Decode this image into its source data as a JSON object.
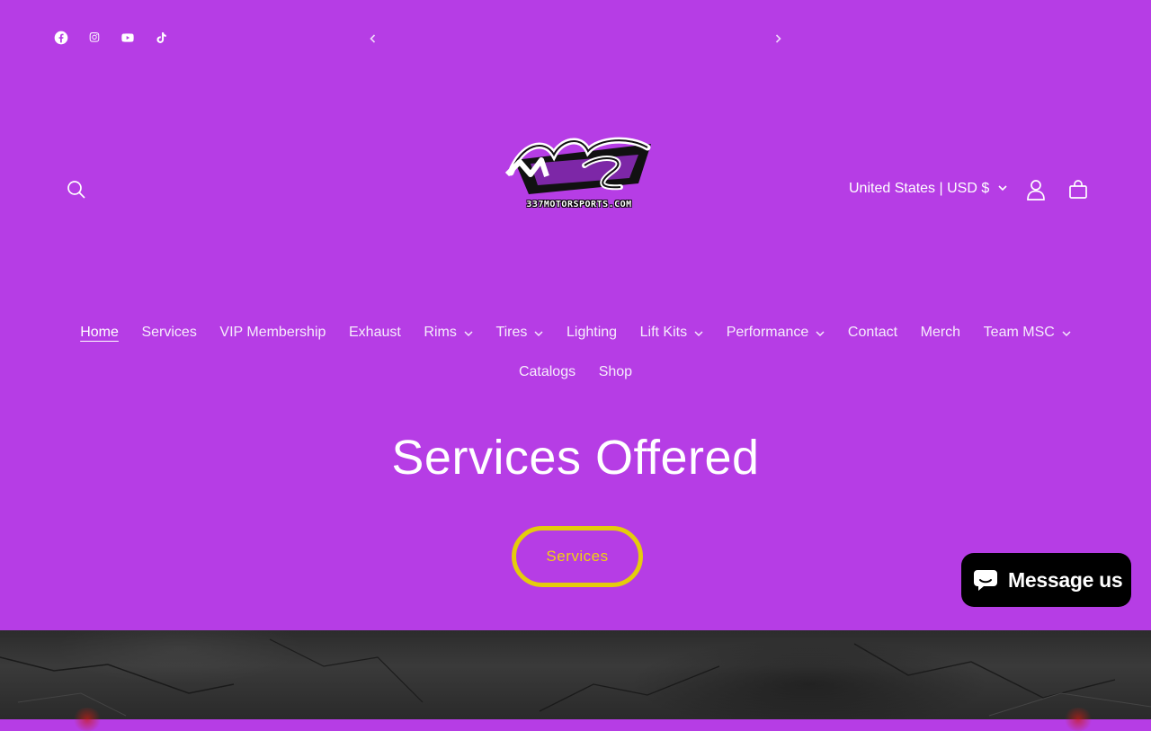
{
  "announcement": {
    "social_icons": [
      "facebook-icon",
      "instagram-icon",
      "youtube-icon",
      "tiktok-icon"
    ],
    "prev_icon": "chevron-left-icon",
    "next_icon": "chevron-right-icon"
  },
  "header": {
    "logo_text": "337MOTORSPORTS.COM",
    "logo_letters": "MS",
    "country_selector": "United States | USD $",
    "icons": {
      "search": "search-icon",
      "account": "user-icon",
      "cart": "bag-icon"
    }
  },
  "nav": {
    "row1": [
      {
        "label": "Home",
        "dropdown": false,
        "active": true
      },
      {
        "label": "Services",
        "dropdown": false
      },
      {
        "label": "VIP Membership",
        "dropdown": false
      },
      {
        "label": "Exhaust",
        "dropdown": false
      },
      {
        "label": "Rims",
        "dropdown": true
      },
      {
        "label": "Tires",
        "dropdown": true
      },
      {
        "label": "Lighting",
        "dropdown": false
      },
      {
        "label": "Lift Kits",
        "dropdown": true
      },
      {
        "label": "Performance",
        "dropdown": true
      },
      {
        "label": "Contact",
        "dropdown": false
      },
      {
        "label": "Merch",
        "dropdown": false
      },
      {
        "label": "Team MSC",
        "dropdown": true
      }
    ],
    "row2": [
      {
        "label": "Catalogs",
        "dropdown": false
      },
      {
        "label": "Shop",
        "dropdown": false
      }
    ]
  },
  "hero": {
    "title": "Services Offered",
    "button_label": "Services"
  },
  "chat": {
    "label": "Message us",
    "icon": "chat-bubble-icon"
  },
  "colors": {
    "background": "#b63de5",
    "button_border": "#e4cc0c",
    "chat_bg": "#000000"
  }
}
